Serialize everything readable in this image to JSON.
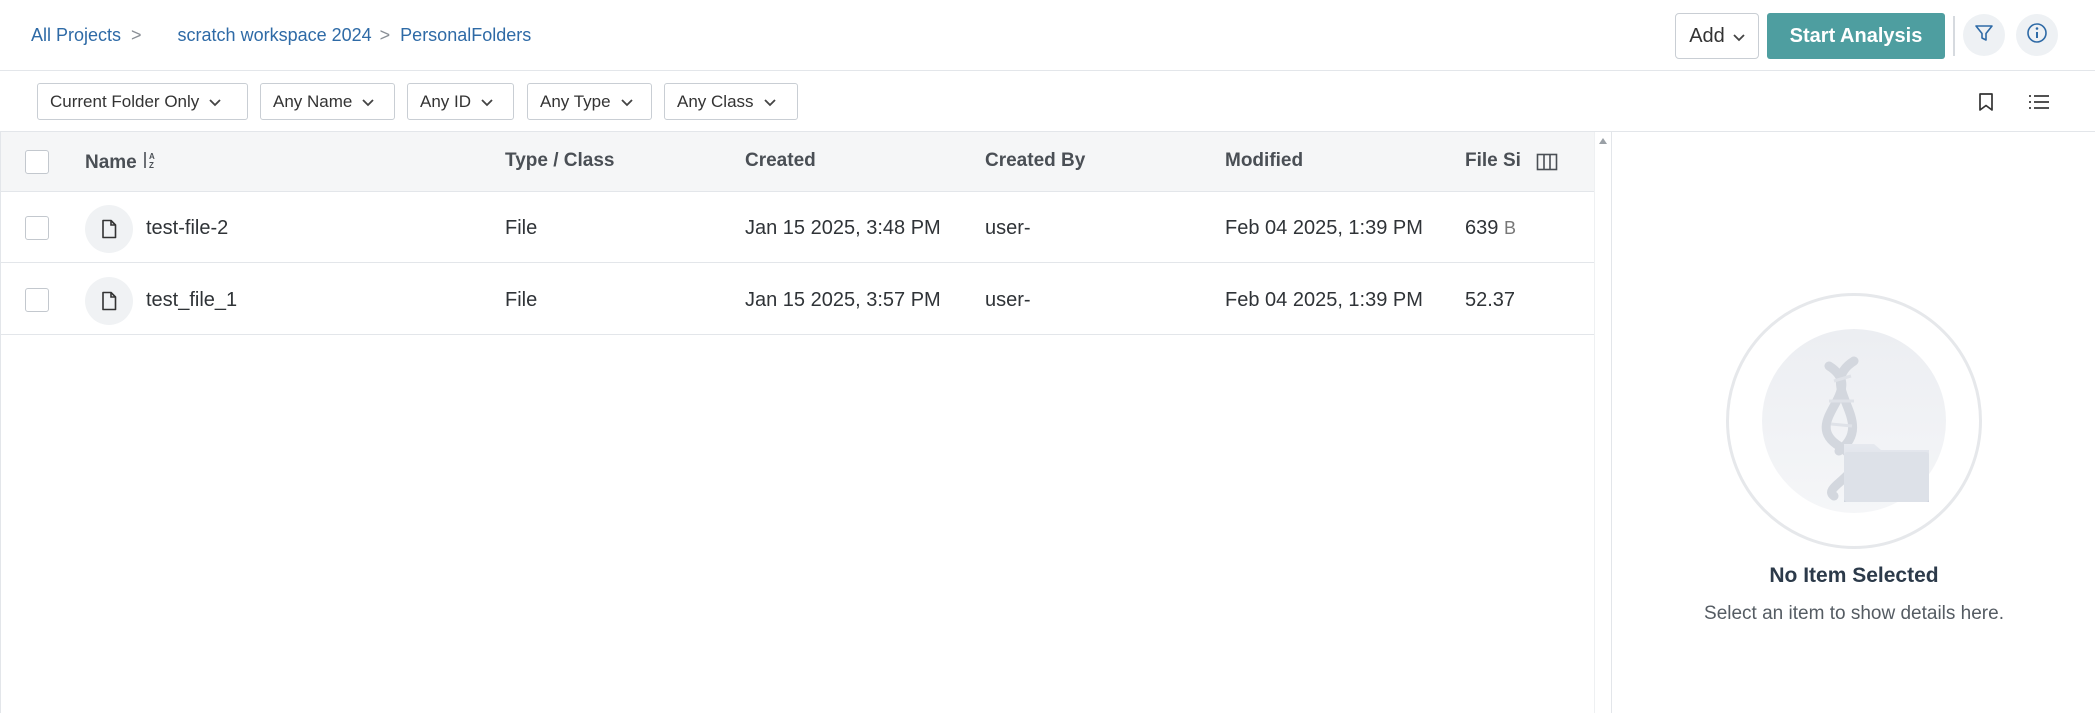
{
  "breadcrumb": {
    "root": "All Projects",
    "sep": ">",
    "project": "scratch workspace 2024",
    "folder": "PersonalFolders"
  },
  "header": {
    "add_label": "Add",
    "start_label": "Start Analysis"
  },
  "filters": {
    "scope": "Current Folder Only",
    "name": "Any Name",
    "id": "Any ID",
    "type": "Any Type",
    "class": "Any Class"
  },
  "table": {
    "columns": {
      "name": "Name",
      "type_class": "Type / Class",
      "created": "Created",
      "created_by": "Created By",
      "modified": "Modified",
      "file_size": "File Si:"
    },
    "rows": [
      {
        "name": "test-file-2",
        "type": "File",
        "created": "Jan 15 2025, 3:48 PM",
        "created_by": "user-",
        "modified": "Feb 04 2025, 1:39 PM",
        "size": "639",
        "size_unit": "B"
      },
      {
        "name": "test_file_1",
        "type": "File",
        "created": "Jan 15 2025, 3:57 PM",
        "created_by": "user-",
        "modified": "Feb 04 2025, 1:39 PM",
        "size": "52.37",
        "size_unit": ""
      }
    ]
  },
  "detail": {
    "title": "No Item Selected",
    "subtitle": "Select an item to show details here."
  },
  "colors": {
    "accent": "#4e9ea0",
    "link": "#2e6aa6"
  },
  "icons": [
    "filter-icon",
    "info-icon",
    "bookmark-icon",
    "list-view-icon",
    "columns-icon",
    "file-icon",
    "sort-icon",
    "chevron-down-icon"
  ]
}
